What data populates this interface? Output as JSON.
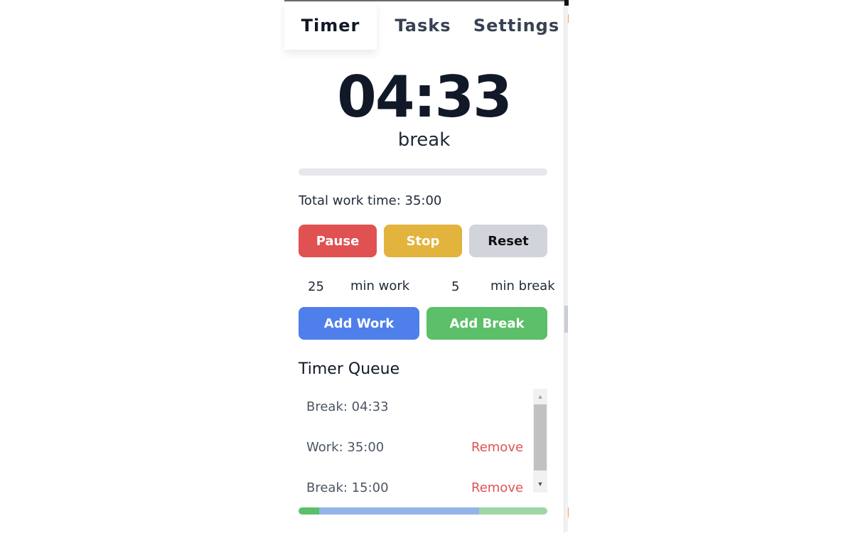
{
  "tabs": [
    {
      "label": "Timer",
      "active": true
    },
    {
      "label": "Tasks",
      "active": false
    },
    {
      "label": "Settings",
      "active": false
    }
  ],
  "timer": {
    "display": "04:33",
    "mode": "break",
    "progress_percent": 0
  },
  "total_work": "Total work time: 35:00",
  "controls": {
    "pause": "Pause",
    "stop": "Stop",
    "reset": "Reset"
  },
  "inputs": {
    "work_minutes": "25",
    "work_label": "min work",
    "break_minutes": "5",
    "break_label": "min break"
  },
  "add_buttons": {
    "add_work": "Add Work",
    "add_break": "Add Break"
  },
  "queue": {
    "title": "Timer Queue",
    "items": [
      {
        "label": "Break: 04:33",
        "remove": null
      },
      {
        "label": "Work: 35:00",
        "remove": "Remove"
      },
      {
        "label": "Break: 15:00",
        "remove": "Remove"
      }
    ],
    "segments": [
      {
        "type": "break-current",
        "minutes": 4.55,
        "color": "#5cbf69"
      },
      {
        "type": "work",
        "minutes": 35,
        "color": "#94b3e8"
      },
      {
        "type": "break",
        "minutes": 15,
        "color": "#9fd6a6"
      }
    ]
  },
  "colors": {
    "pause": "#e05252",
    "stop": "#e2b33d",
    "reset": "#d1d5db",
    "add_work": "#4f7fea",
    "add_break": "#5cbf69",
    "remove": "#e05252"
  }
}
